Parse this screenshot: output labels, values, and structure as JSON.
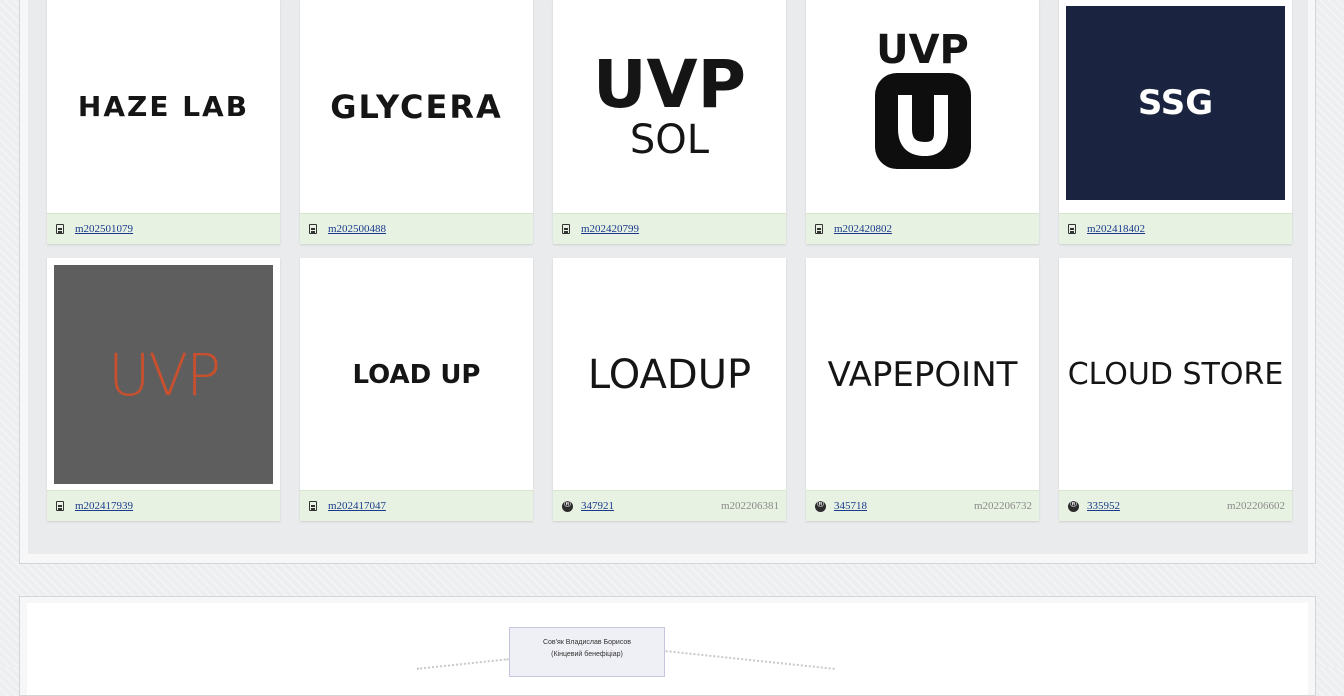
{
  "cards": [
    {
      "logo": "HAZE LAB",
      "code": "m202501079",
      "kind": "doc"
    },
    {
      "logo": "GLYCERA",
      "code": "m202500488",
      "kind": "doc"
    },
    {
      "logo_line1": "UVP",
      "logo_line2": "SOL",
      "code": "m202420799",
      "kind": "doc"
    },
    {
      "logo": "UVP",
      "code": "m202420802",
      "kind": "doc"
    },
    {
      "logo": "SSG",
      "code": "m202418402",
      "kind": "doc"
    },
    {
      "logo": "UVP",
      "code": "m202417939",
      "kind": "doc"
    },
    {
      "logo": "LOAD UP",
      "code": "m202417047",
      "kind": "doc"
    },
    {
      "logo": "LOADUP",
      "code": "347921",
      "right": "m202206381",
      "kind": "reg"
    },
    {
      "logo": "VAPEPOINT",
      "code": "345718",
      "right": "m202206732",
      "kind": "reg"
    },
    {
      "logo": "CLOUD STORE",
      "code": "335952",
      "right": "m202206602",
      "kind": "reg"
    }
  ],
  "colors": {
    "ssg_bg": "#1a2440",
    "uvp_grey_bg": "#5e5e5e",
    "uvp_orange": "#c8502f",
    "meta_bg": "#e8f2e2",
    "link": "#1a3b8c"
  },
  "diagram": {
    "node_line1": "Сов'як Владислав Борисов",
    "node_line2": "(Кінцевий бенефіціар)"
  }
}
